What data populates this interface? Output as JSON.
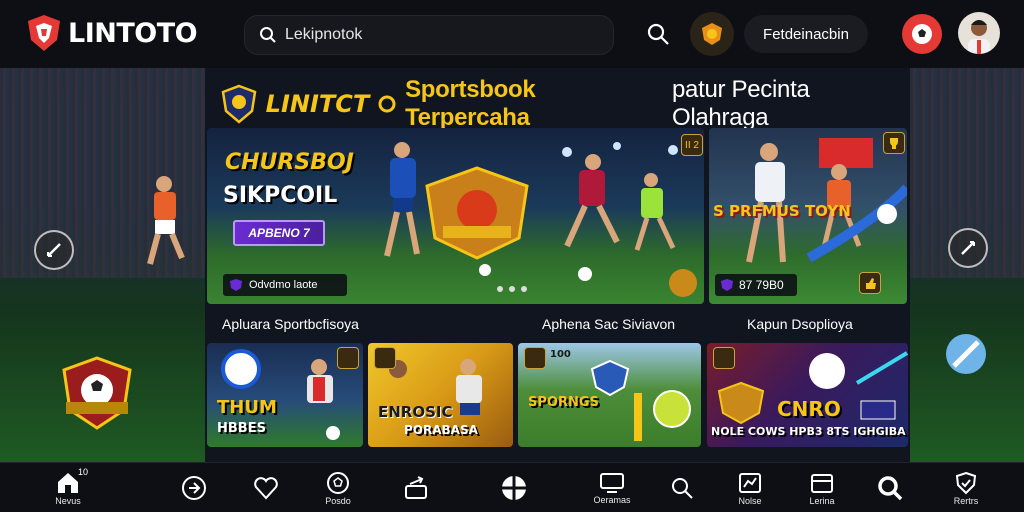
{
  "header": {
    "logo_text": "LINTOTO",
    "search_value": "Lekipnotok",
    "action_label": "Fetdeinacbin"
  },
  "panel": {
    "title_brand": "LINITCT",
    "title_main": "Sportsbook Terpercaha",
    "title_rest": "patur Pecinta Olahraga"
  },
  "hero": {
    "heading_1": "CHURSBOJ",
    "heading_2": "SIKPCOIL",
    "button_label": "APBENO 7",
    "footer_label": "Odvdmo laote",
    "corner_badge": "II 2"
  },
  "side_card": {
    "heading": "S PRFMUS TOYN",
    "footer_label": "87 79B0"
  },
  "sections": {
    "label_1": "Apluara Sportbcfisoya",
    "label_2": "Aphena Sac Siviavon",
    "label_3": "Kapun Dsoplioya"
  },
  "thumbs": {
    "t1_line1": "THUM",
    "t1_line2": "HBBES",
    "t2_line1": "ENROSIC",
    "t2_line2": "PORABASA",
    "t3_line1": "SPORNGS",
    "t3_badge": "100",
    "t4_line1": "CNRO",
    "t4_line2": "NOLE COWS  HPB3 8TS  IGHGIBA"
  },
  "bottom_nav": {
    "item_0": "Nevus",
    "item_1": "",
    "item_2": "",
    "item_3": "Posdo",
    "item_4": "",
    "item_5": "",
    "item_6": "Oeramas",
    "item_7": "",
    "item_8": "Nolse",
    "item_9": "Lerina",
    "item_10": "",
    "item_11": "Rertrs",
    "badge": "10"
  },
  "colors": {
    "accent_gold": "#f5c518",
    "brand_red": "#e53935",
    "promo_purple": "#6b2bd4"
  },
  "icons": [
    "home-icon",
    "compass-icon",
    "heart-icon",
    "soccer-icon",
    "reload-icon",
    "ball-icon",
    "monitor-icon",
    "search-icon",
    "chart-icon",
    "wallet-icon",
    "search-bold-icon",
    "shield-icon"
  ]
}
